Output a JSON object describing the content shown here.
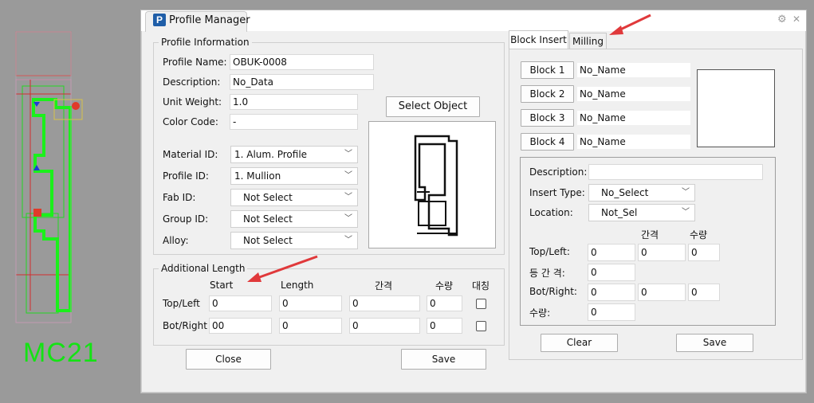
{
  "cad": {
    "label": "MC21"
  },
  "window": {
    "title": "Profile Manager",
    "app_icon": "P"
  },
  "profile_info": {
    "title": "Profile Information",
    "fields": [
      {
        "label": "Profile Name:",
        "value": "OBUK-0008"
      },
      {
        "label": "Description:",
        "value": "No_Data"
      },
      {
        "label": "Unit Weight:",
        "value": "1.0"
      },
      {
        "label": "Color Code:",
        "value": "-"
      }
    ],
    "selects": [
      {
        "label": "Material ID:",
        "value": "1. Alum. Profile"
      },
      {
        "label": "Profile ID:",
        "value": "1. Mullion"
      },
      {
        "label": "Fab ID:",
        "value": "Not Select"
      },
      {
        "label": "Group ID:",
        "value": "Not Select"
      },
      {
        "label": "Alloy:",
        "value": "Not Select"
      }
    ],
    "select_object_label": "Select Object"
  },
  "additional_length": {
    "title": "Additional Length",
    "headers": [
      "Start",
      "Length",
      "간격",
      "수량",
      "대칭"
    ],
    "rows": [
      {
        "label": "Top/Left",
        "start": "0",
        "length": "0",
        "gap": "0",
        "qty": "0"
      },
      {
        "label": "Bot/Right",
        "start": "00",
        "length": "0",
        "gap": "0",
        "qty": "0"
      }
    ]
  },
  "buttons": {
    "close": "Close",
    "save": "Save"
  },
  "tabs": [
    "Block Insert",
    "Milling"
  ],
  "block_insert": {
    "blocks": [
      {
        "button": "Block 1",
        "name": "No_Name"
      },
      {
        "button": "Block 2",
        "name": "No_Name"
      },
      {
        "button": "Block 3",
        "name": "No_Name"
      },
      {
        "button": "Block 4",
        "name": "No_Name"
      }
    ],
    "description_label": "Description:",
    "description_value": "",
    "insert_type_label": "Insert Type:",
    "insert_type_value": "No_Select",
    "location_label": "Location:",
    "location_value": "Not_Sel",
    "col_headers": [
      "간격",
      "수량"
    ],
    "top_left": {
      "label": "Top/Left:",
      "value": "0",
      "gap": "0",
      "qty": "0"
    },
    "equal_gap": {
      "label": "등 간 격:",
      "value": "0"
    },
    "bot_right": {
      "label": "Bot/Right:",
      "value": "0",
      "gap": "0",
      "qty": "0"
    },
    "count": {
      "label": "수량:",
      "value": "0"
    },
    "clear_label": "Clear",
    "save_label": "Save"
  },
  "colors": {
    "accent_arrow": "#e0393b",
    "cad_text": "#14e314",
    "app_icon": "#1f5ea8"
  }
}
